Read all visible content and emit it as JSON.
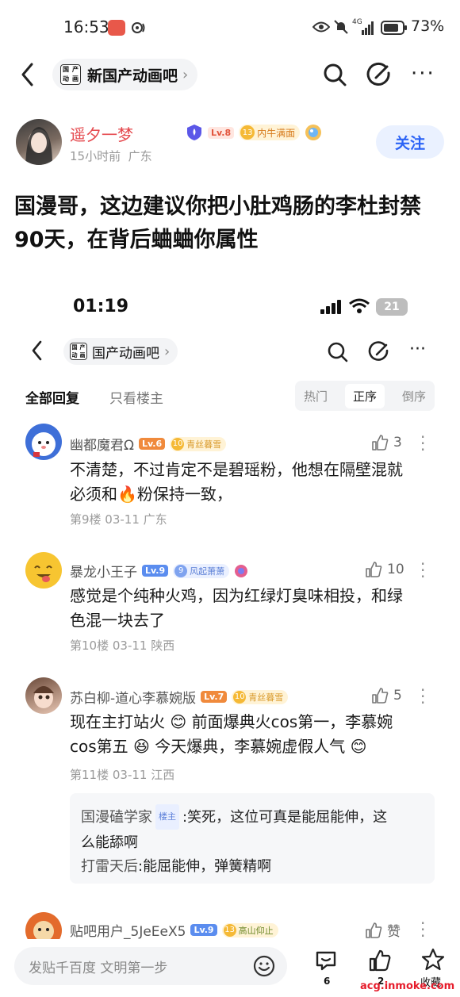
{
  "status_bar": {
    "time": "16:53",
    "network": "4G",
    "battery_pct": "73%"
  },
  "nav": {
    "forum_name": "新国产动画吧",
    "forum_logo_chars": [
      "国",
      "产",
      "动",
      "画"
    ]
  },
  "author": {
    "name": "遥夕一梦",
    "level": "Lv.8",
    "title_num": "13",
    "title": "内牛满面",
    "meta_time": "15小时前",
    "meta_loc": "广东",
    "follow_label": "关注"
  },
  "post": {
    "title": "国漫哥，这边建议你把小肚鸡肠的李杜封禁90天，在背后蛐蛐你属性"
  },
  "embedded": {
    "status_time": "01:19",
    "battery": "21",
    "forum_name": "国产动画吧",
    "tabs": [
      "全部回复",
      "只看楼主"
    ],
    "sort": [
      "热门",
      "正序",
      "倒序"
    ],
    "sort_active": "正序",
    "comments": [
      {
        "name": "幽都魔君Ω",
        "level": "Lv.6",
        "title_num": "10",
        "title": "青丝暮雪",
        "likes": "3",
        "text1": "不清楚，不过肯定不是碧瑶粉，他想在隔壁混就",
        "text2a": "必须和",
        "text2b": "粉保持一致，",
        "meta": "第9楼  03-11  广东"
      },
      {
        "name": "暴龙小王子",
        "level": "Lv.9",
        "title_num": "9",
        "title": "风起萧萧",
        "likes": "10",
        "text1": "感觉是个纯种火鸡，因为红绿灯臭味相投，和绿",
        "text2": "色混一块去了",
        "meta": "第10楼  03-11  陕西"
      },
      {
        "name": "苏白柳-道心李慕婉版",
        "level": "Lv.7",
        "title_num": "10",
        "title": "青丝暮雪",
        "likes": "5",
        "text1a": "现在主打站火",
        "text1b": "前面爆典火cos第一，李慕婉",
        "text2a": "cos第五",
        "text2b": "今天爆典，李慕婉虚假人气",
        "meta": "第11楼  03-11  江西"
      },
      {
        "name": "贴吧用户_5JeEeX5",
        "level": "Lv.9",
        "title_num": "13",
        "title": "高山仰止",
        "likes": "赞"
      }
    ],
    "replies": [
      {
        "name": "国漫磕学家",
        "tag": "楼主",
        "text1": ":笑死，这位可真是能屈能伸，这",
        "text2": "么能舔啊"
      },
      {
        "name": "打雷天后",
        "text1": ":能屈能伸，弹簧精啊"
      }
    ]
  },
  "bottom_bar": {
    "input_placeholder": "发贴千百度 文明第一步",
    "comment_count": "6",
    "like_count": "2",
    "favorite_label": "收藏"
  },
  "watermark": "acg.inmoke.com",
  "colors": {
    "accent": "#2b63f6",
    "level_blue": "#5b8def",
    "level_orange": "#f08a3c",
    "title_gold": "#f5b936"
  }
}
